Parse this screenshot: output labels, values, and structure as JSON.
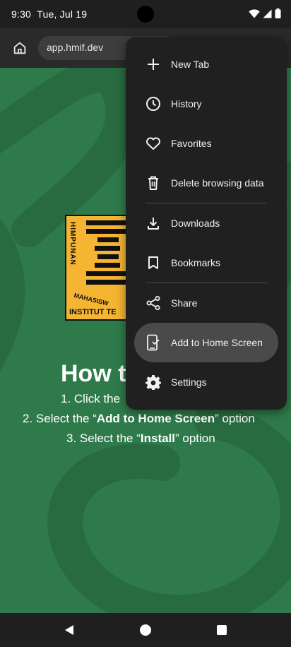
{
  "status_bar": {
    "time": "9:30",
    "date": "Tue, Jul 19",
    "icons": [
      "wifi-icon",
      "signal-icon",
      "battery-icon"
    ]
  },
  "toolbar": {
    "url": "app.hmif.dev",
    "home_icon": "home-icon"
  },
  "page": {
    "logo": {
      "vertical_text": "HIMPUNAN",
      "small_text": "MAHASISW",
      "bottom_text": "INSTITUT TE"
    },
    "heading": "How t",
    "steps": [
      {
        "pre": "1. Click the ",
        "bold": "",
        "post": ""
      },
      {
        "pre": "2. Select the “",
        "bold": "Add to Home Screen",
        "post": "” option"
      },
      {
        "pre": "3. Select the “",
        "bold": "Install",
        "post": "” option"
      }
    ]
  },
  "menu": {
    "items": [
      {
        "label": "New Tab",
        "icon": "plus-icon"
      },
      {
        "label": "History",
        "icon": "clock-icon"
      },
      {
        "label": "Favorites",
        "icon": "heart-icon"
      },
      {
        "label": "Delete browsing data",
        "icon": "trash-icon"
      },
      {
        "label": "Downloads",
        "icon": "download-icon"
      },
      {
        "label": "Bookmarks",
        "icon": "bookmark-icon"
      },
      {
        "label": "Share",
        "icon": "share-icon"
      },
      {
        "label": "Add to Home Screen",
        "icon": "add-to-home-icon",
        "active": true
      },
      {
        "label": "Settings",
        "icon": "settings-icon"
      }
    ]
  },
  "nav_bar": {
    "buttons": [
      "back-icon",
      "home-circle-icon",
      "recents-icon"
    ]
  },
  "colors": {
    "page_background": "#2f7a4a",
    "menu_background": "#202020",
    "menu_active": "#4a4a4a",
    "logo_yellow": "#f5b533"
  }
}
